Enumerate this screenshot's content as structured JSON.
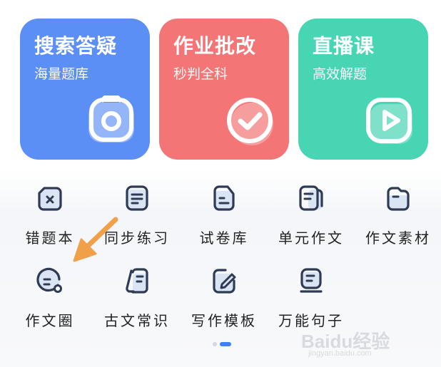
{
  "colors": {
    "card_search": "#5b8ff5",
    "card_homework": "#f37575",
    "card_live": "#48d5b4",
    "icon_stroke": "#2f3b55",
    "icon_fill": "#dbe4f3",
    "arrow": "#f1a04a",
    "pager_active": "#3c82f6"
  },
  "cards": [
    {
      "title": "搜索答疑",
      "subtitle": "海量题库",
      "icon": "camera-icon"
    },
    {
      "title": "作业批改",
      "subtitle": "秒判全科",
      "icon": "check-circle-icon"
    },
    {
      "title": "直播课",
      "subtitle": "高效解题",
      "icon": "play-icon"
    }
  ],
  "grid": [
    {
      "label": "错题本",
      "icon": "wrong-notebook-icon"
    },
    {
      "label": "同步练习",
      "icon": "sync-practice-icon"
    },
    {
      "label": "试卷库",
      "icon": "exam-paper-icon"
    },
    {
      "label": "单元作文",
      "icon": "unit-essay-icon"
    },
    {
      "label": "作文素材",
      "icon": "essay-material-icon"
    },
    {
      "label": "作文圈",
      "icon": "essay-circle-icon"
    },
    {
      "label": "古文常识",
      "icon": "classical-chinese-icon"
    },
    {
      "label": "写作模板",
      "icon": "writing-template-icon"
    },
    {
      "label": "万能句子",
      "icon": "sentence-icon"
    }
  ],
  "watermark": {
    "text": "Baidu经验",
    "url": "jingyan.baidu.com"
  }
}
